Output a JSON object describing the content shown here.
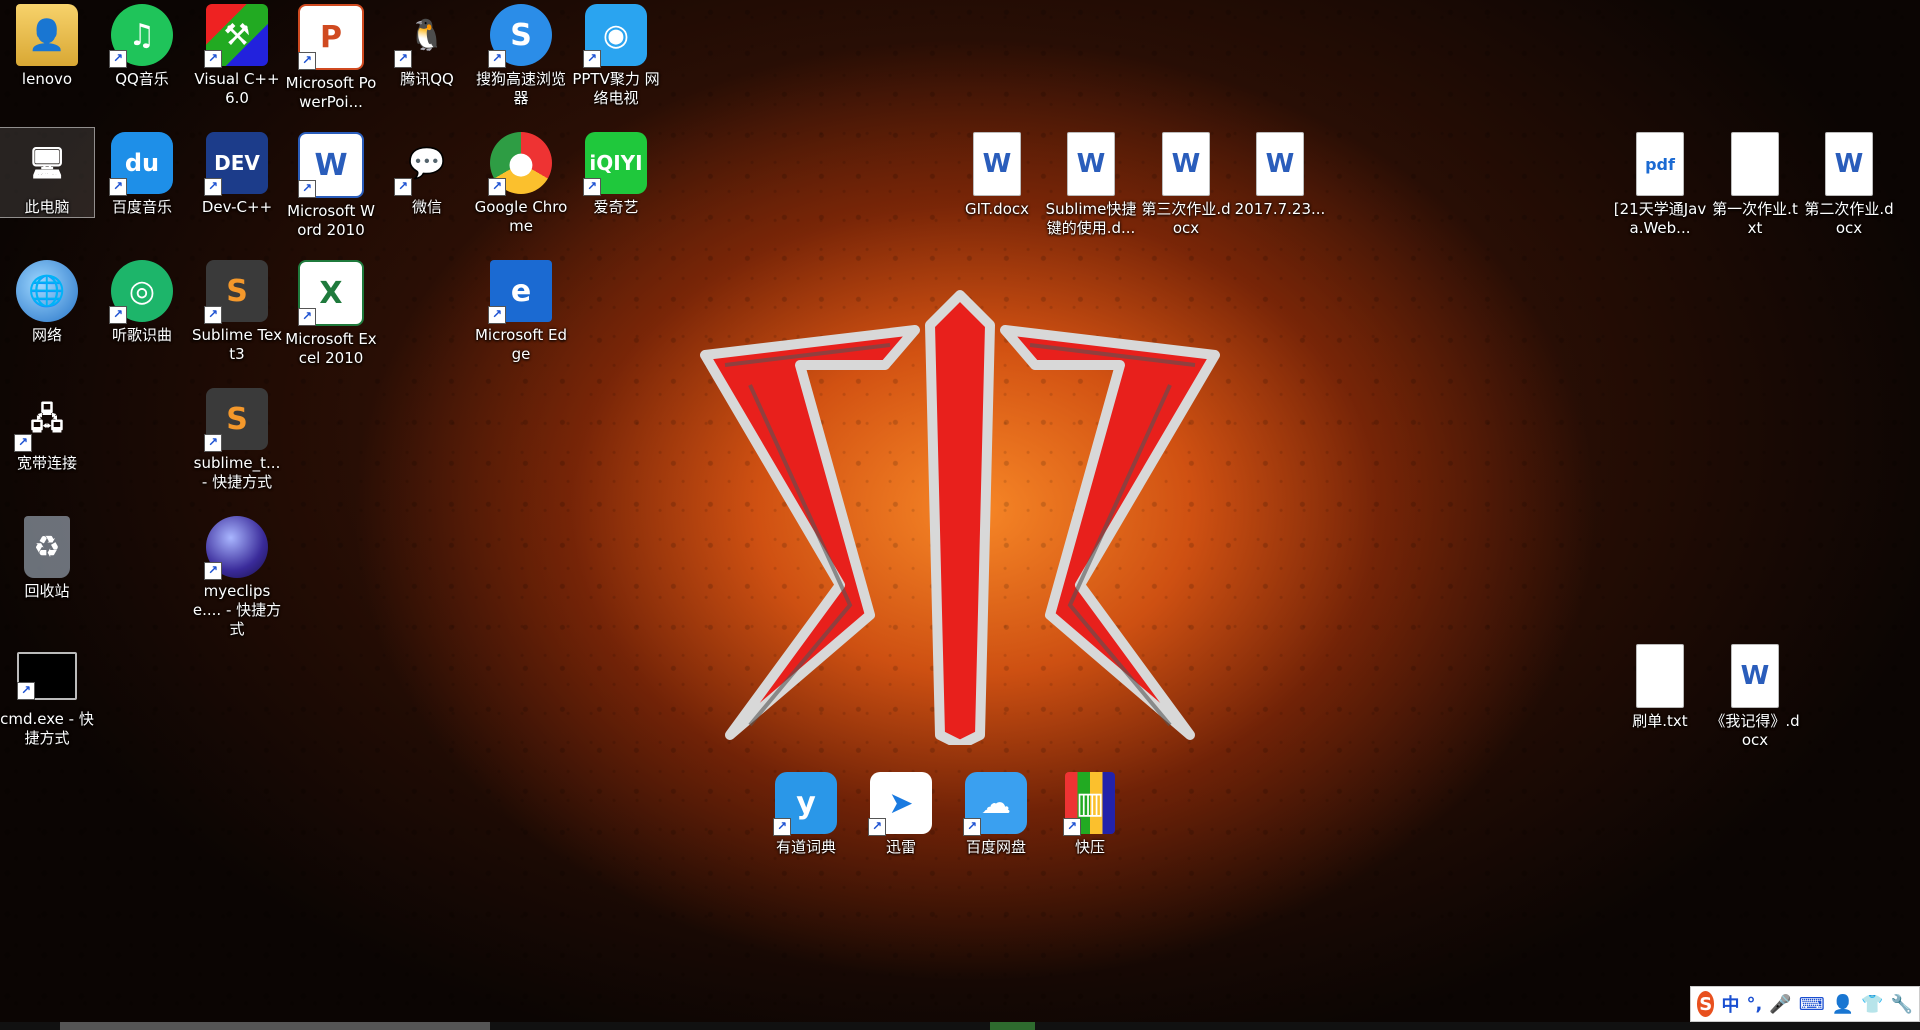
{
  "desktop": {
    "icons": [
      {
        "name": "lenovo",
        "label": "lenovo",
        "icon": "user-folder-icon",
        "shortcut": false
      },
      {
        "name": "qqmusic",
        "label": "QQ音乐",
        "icon": "qq-music-icon",
        "shortcut": true
      },
      {
        "name": "vcpp",
        "label": "Visual C++ 6.0",
        "icon": "visual-cpp-icon",
        "shortcut": true
      },
      {
        "name": "powerpoint",
        "label": "Microsoft PowerPoi...",
        "icon": "powerpoint-icon",
        "shortcut": true
      },
      {
        "name": "tencent-qq",
        "label": "腾讯QQ",
        "icon": "qq-penguin-icon",
        "shortcut": true
      },
      {
        "name": "sogou-browser",
        "label": "搜狗高速浏览器",
        "icon": "sogou-browser-icon",
        "shortcut": true
      },
      {
        "name": "pptv",
        "label": "PPTV聚力 网络电视",
        "icon": "pptv-icon",
        "shortcut": true
      },
      {
        "name": "this-pc",
        "label": "此电脑",
        "icon": "computer-icon",
        "shortcut": false
      },
      {
        "name": "baidu-music",
        "label": "百度音乐",
        "icon": "baidu-music-icon",
        "shortcut": true
      },
      {
        "name": "devcpp",
        "label": "Dev-C++",
        "icon": "dev-cpp-icon",
        "shortcut": true
      },
      {
        "name": "word",
        "label": "Microsoft Word 2010",
        "icon": "word-icon",
        "shortcut": true
      },
      {
        "name": "wechat",
        "label": "微信",
        "icon": "wechat-icon",
        "shortcut": true
      },
      {
        "name": "chrome",
        "label": "Google Chrome",
        "icon": "chrome-icon",
        "shortcut": true
      },
      {
        "name": "iqiyi",
        "label": "爱奇艺",
        "icon": "iqiyi-icon",
        "shortcut": true
      },
      {
        "name": "network",
        "label": "网络",
        "icon": "network-globe-icon",
        "shortcut": false
      },
      {
        "name": "tingge",
        "label": "听歌识曲",
        "icon": "tingge-icon",
        "shortcut": true
      },
      {
        "name": "sublime",
        "label": "Sublime Text3",
        "icon": "sublime-icon",
        "shortcut": true
      },
      {
        "name": "excel",
        "label": "Microsoft Excel 2010",
        "icon": "excel-icon",
        "shortcut": true
      },
      {
        "name": "edge",
        "label": "Microsoft Edge",
        "icon": "edge-icon",
        "shortcut": true
      },
      {
        "name": "broadband",
        "label": "宽带连接",
        "icon": "broadband-icon",
        "shortcut": true
      },
      {
        "name": "sublime-shortcut",
        "label": "sublime_t... - 快捷方式",
        "icon": "sublime-icon",
        "shortcut": true
      },
      {
        "name": "recycle-bin",
        "label": "回收站",
        "icon": "recycle-bin-icon",
        "shortcut": false
      },
      {
        "name": "myeclipse",
        "label": "myeclipse.... - 快捷方式",
        "icon": "myeclipse-icon",
        "shortcut": true
      },
      {
        "name": "cmd",
        "label": "cmd.exe - 快捷方式",
        "icon": "cmd-icon",
        "shortcut": true
      },
      {
        "name": "git-docx",
        "label": "GIT.docx",
        "icon": "word-doc-icon",
        "shortcut": false
      },
      {
        "name": "sublime-docx",
        "label": "Sublime快捷键的使用.d...",
        "icon": "word-doc-icon",
        "shortcut": false
      },
      {
        "name": "third-hw",
        "label": "第三次作业.docx",
        "icon": "word-doc-icon",
        "shortcut": false
      },
      {
        "name": "date-doc",
        "label": "2017.7.23...",
        "icon": "word-doc-icon",
        "shortcut": false
      },
      {
        "name": "java-web-pdf",
        "label": "[21天学通Java.Web...",
        "icon": "pdf-icon",
        "shortcut": false
      },
      {
        "name": "first-hw",
        "label": "第一次作业.txt",
        "icon": "text-file-icon",
        "shortcut": false
      },
      {
        "name": "second-hw",
        "label": "第二次作业.docx",
        "icon": "word-doc-icon",
        "shortcut": false
      },
      {
        "name": "shuadan",
        "label": "刷单.txt",
        "icon": "text-file-icon",
        "shortcut": false
      },
      {
        "name": "wojide",
        "label": "《我记得》.docx",
        "icon": "word-doc-icon",
        "shortcut": false
      },
      {
        "name": "youdao",
        "label": "有道词典",
        "icon": "youdao-icon",
        "shortcut": true
      },
      {
        "name": "xunlei",
        "label": "迅雷",
        "icon": "xunlei-bird-icon",
        "shortcut": true
      },
      {
        "name": "baidu-pan",
        "label": "百度网盘",
        "icon": "baidu-pan-icon",
        "shortcut": true
      },
      {
        "name": "kuaiya",
        "label": "快压",
        "icon": "kuaiya-icon",
        "shortcut": true
      }
    ]
  },
  "ime_toolbar": {
    "logo": "S",
    "mode": "中",
    "items": [
      "°,",
      "🎤",
      "⌨",
      "👤",
      "👕",
      "🔧"
    ]
  },
  "colors": {
    "logo_red": "#e8201c",
    "logo_silver": "#c8c8c8",
    "glow_orange": "#ff8c28"
  }
}
